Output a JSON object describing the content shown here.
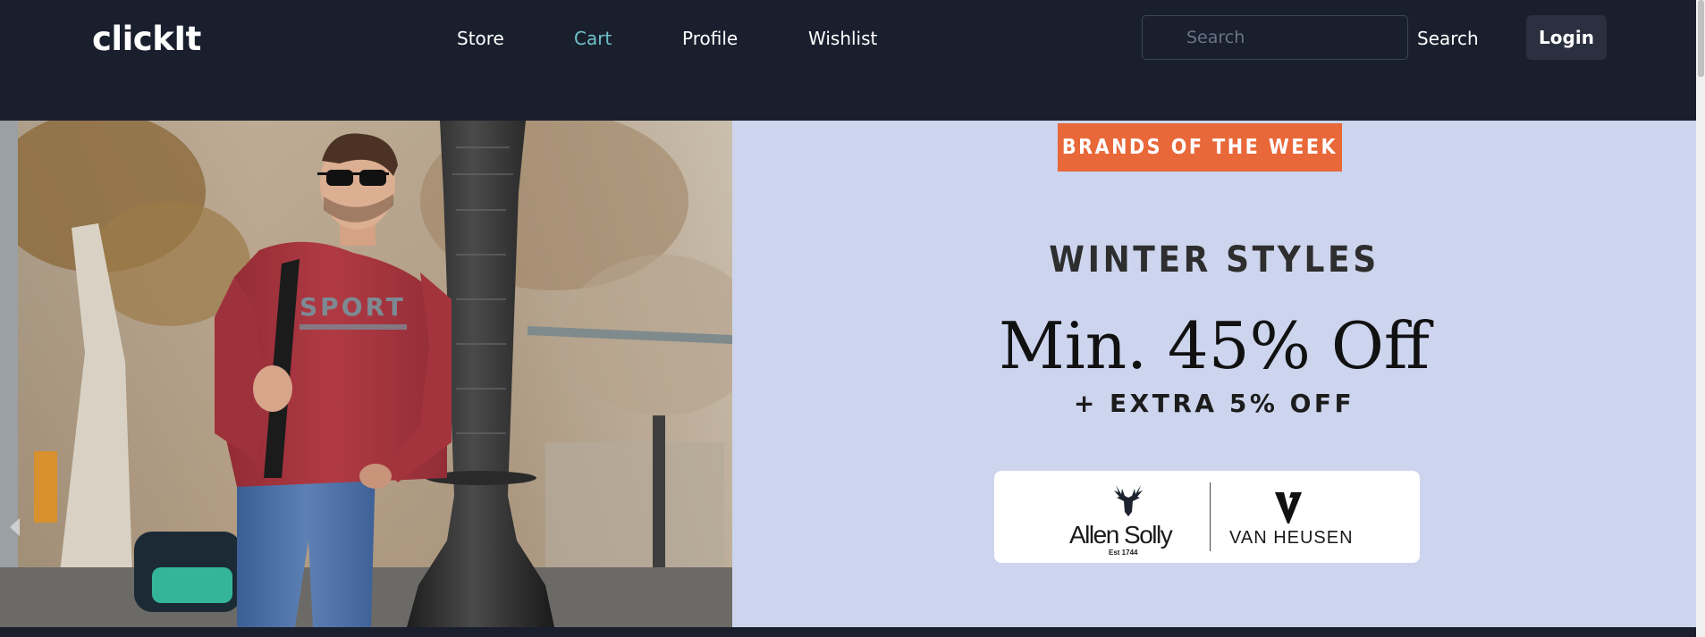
{
  "navbar": {
    "brand": "clickIt",
    "links": [
      {
        "label": "Store",
        "active": false
      },
      {
        "label": "Cart",
        "active": true
      },
      {
        "label": "Profile",
        "active": false
      },
      {
        "label": "Wishlist",
        "active": false
      }
    ],
    "search": {
      "placeholder": "Search",
      "value": "",
      "button_label": "Search"
    },
    "login_label": "Login"
  },
  "hero": {
    "badge": "BRANDS OF THE WEEK",
    "title": "WINTER STYLES",
    "offer": "Min. 45% Off",
    "extra": "+ EXTRA 5% OFF",
    "brands": {
      "allen_solly": "Allen Solly",
      "allen_solly_est": "Est 1744",
      "van_heusen": "VAN HEUSEN"
    },
    "photo_alt": "Man in red Allen Solly sport sweatshirt leaning on street lamp post",
    "sweatshirt_text": "SPORT"
  },
  "colors": {
    "navbar_bg": "#1a1f2e",
    "hero_bg": "#cdd5ee",
    "badge_bg": "#e8683a",
    "active_link": "#6fc2c9",
    "login_bg": "#2b3040"
  },
  "icons": [
    "carousel-prev-icon",
    "stag-icon",
    "vh-logo-icon"
  ]
}
